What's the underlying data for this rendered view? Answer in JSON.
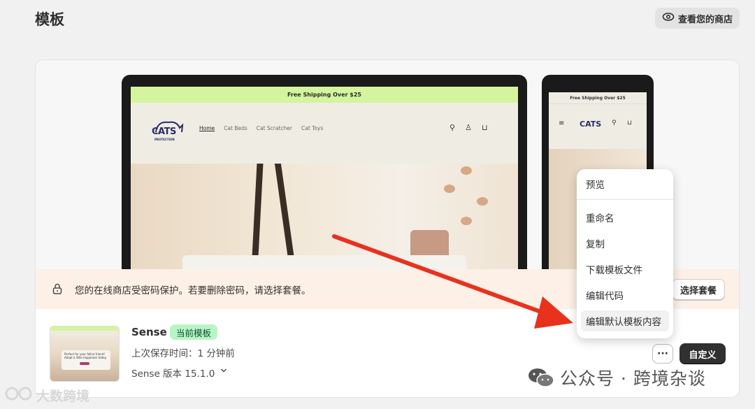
{
  "page": {
    "title": "模板"
  },
  "header": {
    "view_store_label": "查看您的商店"
  },
  "preview": {
    "shipping_text": "Free Shipping Over $25",
    "logo_text": "CATS",
    "logo_subtext": "PROTECTION",
    "nav_links": [
      "Home",
      "Cat Beds",
      "Cat Scratcher",
      "Cat Toys"
    ],
    "thumb_text": "Perfect for your feline friend! Adopt a little happiness today."
  },
  "banner": {
    "message": "您的在线商店受密码保护。若要删除密码，请选择套餐。",
    "button_label": "选择套餐"
  },
  "theme": {
    "name": "Sense",
    "badge": "当前模板",
    "saved_text": "上次保存时间：1 分钟前",
    "version_text": "Sense 版本 15.1.0",
    "more_label": "···",
    "customize_label": "自定义"
  },
  "menu": {
    "items": [
      "预览",
      "重命名",
      "复制",
      "下载模板文件",
      "编辑代码",
      "编辑默认模板内容"
    ]
  },
  "watermarks": {
    "wechat_text": "公众号 · 跨境杂谈",
    "corner_text": "大数跨境"
  },
  "colors": {
    "accent_arrow": "#e8321e",
    "badge_bg": "#b8f5c6",
    "banner_bg": "#fdf0e6",
    "primary_button": "#303030"
  }
}
